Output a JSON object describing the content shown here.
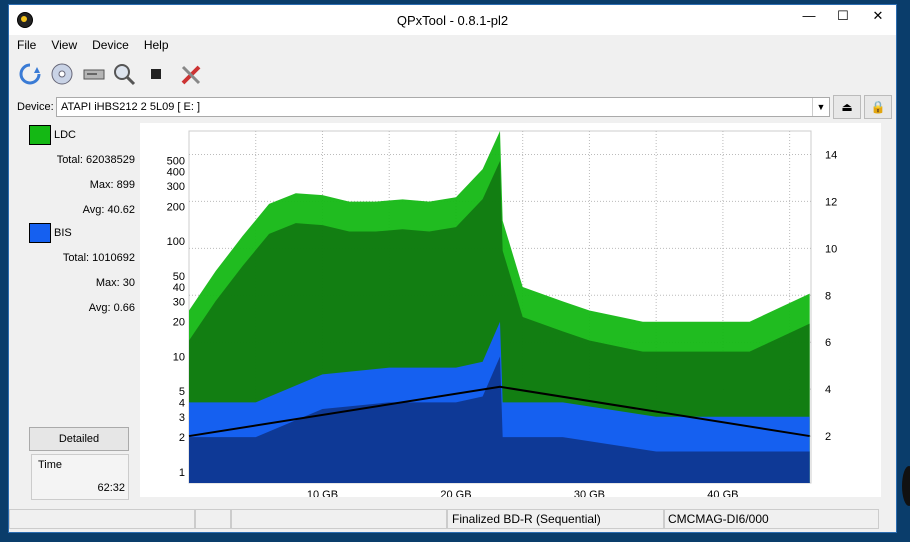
{
  "window": {
    "title": "QPxTool - 0.8.1-pl2",
    "btn_min": "—",
    "btn_max": "☐",
    "btn_close": "✕"
  },
  "menu": [
    "File",
    "View",
    "Device",
    "Help"
  ],
  "toolbar_icons": [
    "refresh-icon",
    "disc-icon",
    "drive-icon",
    "scan-icon",
    "stop-icon",
    "tools-icon"
  ],
  "device": {
    "label": "Device:",
    "value": "ATAPI   iHBS212  2     5L09 [ E: ]",
    "eject": "⏏",
    "lock": "🔒"
  },
  "ldc": {
    "name": "LDC",
    "color": "#14b814",
    "total_label": "Total:",
    "total": "62038529",
    "max_label": "Max:",
    "max": "899",
    "avg_label": "Avg:",
    "avg": "40.62"
  },
  "bis": {
    "name": "BIS",
    "color": "#1560f0",
    "total_label": "Total:",
    "total": "1010692",
    "max_label": "Max:",
    "max": "30",
    "avg_label": "Avg:",
    "avg": "0.66"
  },
  "detailed_label": "Detailed",
  "time": {
    "label": "Time",
    "value": "62:32"
  },
  "status": {
    "s1": "",
    "s2": "",
    "s3": "",
    "disc_type": "Finalized BD-R (Sequential)",
    "media_id": "CMCMAG-DI6/000"
  },
  "chart_data": {
    "type": "area",
    "x_unit": "GB",
    "xlim": [
      0,
      46.6
    ],
    "x_ticks": [
      10,
      20,
      30,
      40
    ],
    "x_tick_labels": [
      "10 GB",
      "20 GB",
      "30 GB",
      "40 GB"
    ],
    "y_left_scale": "log",
    "ylim_left": [
      0.8,
      900
    ],
    "y_left_ticks": [
      1,
      2,
      3,
      4,
      5,
      10,
      20,
      30,
      40,
      50,
      100,
      200,
      300,
      400,
      500
    ],
    "ylim_right": [
      0,
      15
    ],
    "y_right_ticks": [
      2,
      4,
      6,
      8,
      10,
      12,
      14
    ],
    "series": [
      {
        "name": "LDC",
        "color": "#14b814",
        "x": [
          0,
          2,
          4,
          6,
          8,
          10,
          12,
          14,
          16,
          18,
          20,
          22,
          23.3,
          23.5,
          25,
          28,
          30,
          34,
          38,
          42,
          46.5
        ],
        "y": [
          25,
          55,
          110,
          210,
          260,
          250,
          220,
          220,
          230,
          220,
          240,
          420,
          900,
          150,
          40,
          30,
          25,
          20,
          20,
          20,
          35
        ]
      },
      {
        "name": "BIS",
        "color": "#1560f0",
        "x": [
          0,
          5,
          10,
          15,
          20,
          22,
          23.3,
          23.5,
          28,
          35,
          40,
          46.5
        ],
        "y": [
          4,
          4,
          7,
          8,
          8,
          9,
          20,
          4,
          4,
          3,
          3,
          3
        ]
      },
      {
        "name": "Speed",
        "color": "#000000",
        "x": [
          0,
          23.3,
          46.5
        ],
        "y": [
          2.0,
          4.1,
          2.0
        ]
      }
    ]
  }
}
